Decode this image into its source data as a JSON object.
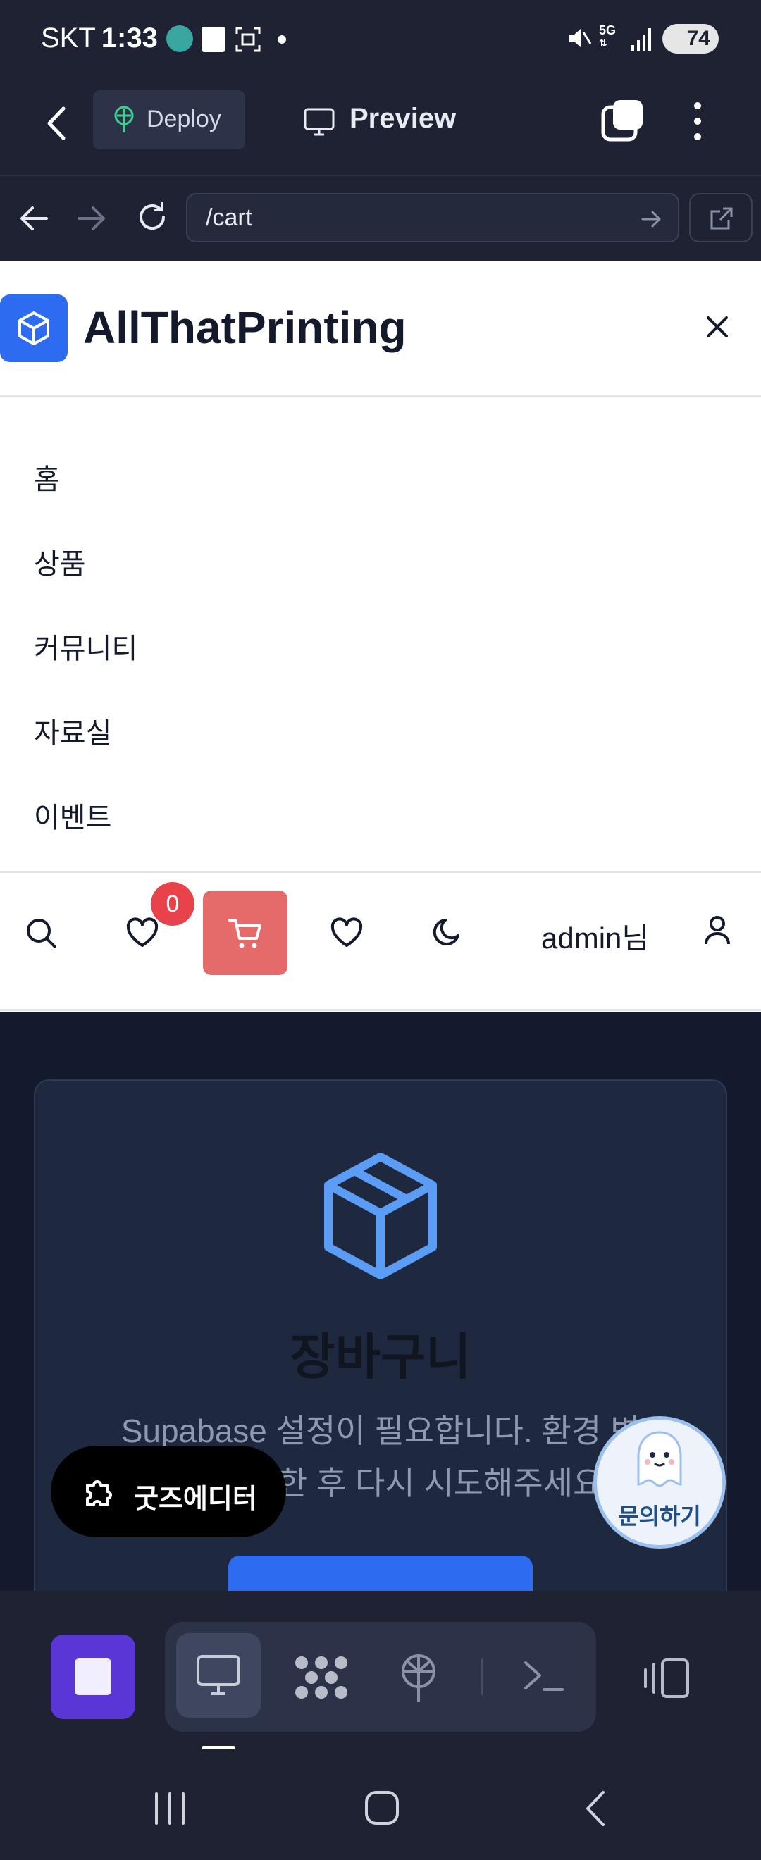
{
  "status_bar": {
    "carrier": "SKT",
    "time": "1:33",
    "network": "5G",
    "battery": "74"
  },
  "app_header": {
    "deploy_label": "Deploy",
    "preview_label": "Preview"
  },
  "browser": {
    "url": "/cart"
  },
  "site": {
    "brand": "AllThatPrinting",
    "nav_items": [
      "홈",
      "상품",
      "커뮤니티",
      "자료실",
      "이벤트"
    ],
    "wishlist_count": "0",
    "user_label": "admin님"
  },
  "cart": {
    "title": "장바구니",
    "message_line1": "Supabase 설정이 필요합니다. 환경 변",
    "message_line2": "수를 설정한 후 다시 시도해주세요."
  },
  "floating": {
    "goods_editor_label": "굿즈에디터",
    "inquiry_label": "문의하기"
  },
  "colors": {
    "accent_blue": "#2d6cf0",
    "cart_red": "#e56a6a",
    "badge_red": "#e8434a",
    "stop_purple": "#5b36d6",
    "chrome_dark": "#1e2233"
  }
}
